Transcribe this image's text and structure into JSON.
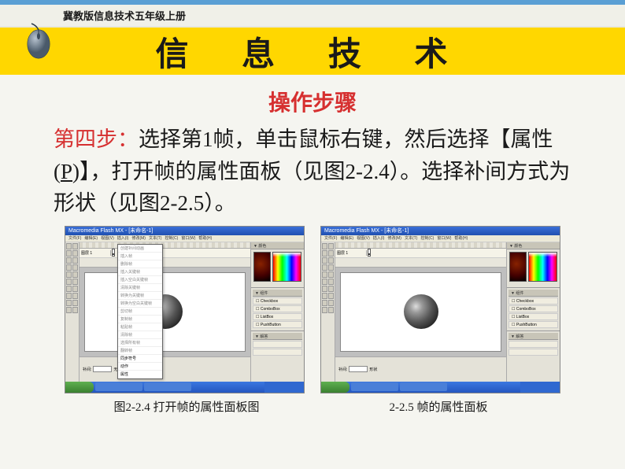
{
  "header": {
    "book_label": "冀教版信息技术五年级上册",
    "banner_title": "信 息 技 术"
  },
  "section": {
    "title": "操作步骤",
    "step_label": "第四步：",
    "body": "选择第1帧，单击鼠标右键，然后选择【属性(",
    "underline_char": "P",
    "body_after": ")】，打开帧的属性面板（见图2-2.4）。选择补间方式为形状（见图2-2.5）。"
  },
  "figures": {
    "left": {
      "app_title": "Macromedia Flash MX - [未命名-1]",
      "caption": "图2-2.4  打开帧的属性面板图",
      "context_items": [
        "创建补间动画",
        "插入帧",
        "删除帧",
        "插入关键帧",
        "插入空白关键帧",
        "清除关键帧",
        "转换为关键帧",
        "转换为空白关键帧",
        "剪切帧",
        "复制帧",
        "粘贴帧",
        "清除帧",
        "选择所有帧",
        "翻转帧",
        "同步符号",
        "动作",
        "属性"
      ],
      "prop_label": "补间:",
      "prop_value": "无"
    },
    "right": {
      "app_title": "Macromedia Flash MX - [未命名-1]",
      "caption": "2-2.5  帧的属性面板",
      "panel_items": [
        "Checkbox",
        "ComboBox",
        "ListBox",
        "PushButton"
      ],
      "prop_label": "补间:",
      "prop_value": "形状"
    },
    "menu_items": [
      "文件(F)",
      "编辑(E)",
      "视图(V)",
      "插入(I)",
      "修改(M)",
      "文本(T)",
      "控制(C)",
      "窗口(W)",
      "帮助(H)"
    ],
    "panel_titles": {
      "color": "▼ 颜色",
      "components": "▼ 组件",
      "answers": "▼ 解答",
      "properties": "▼ 属性"
    }
  }
}
